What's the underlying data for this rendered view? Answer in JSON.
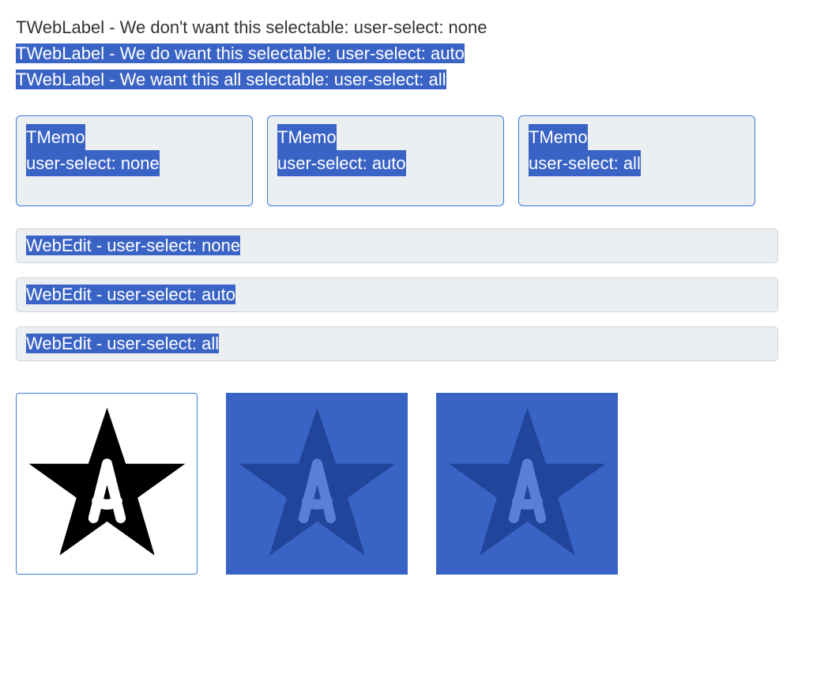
{
  "labels": {
    "none": "TWebLabel - We don't want this selectable: user-select: none",
    "auto": "TWebLabel - We do want this selectable: user-select: auto",
    "all": "TWebLabel - We want this all selectable: user-select: all"
  },
  "memos": {
    "none": {
      "line1": "TMemo",
      "line2": "user-select: none"
    },
    "auto": {
      "line1": "TMemo",
      "line2": "user-select: auto"
    },
    "all": {
      "line1": "TMemo",
      "line2": "user-select: all"
    }
  },
  "edits": {
    "none": "WebEdit - user-select: none",
    "auto": "WebEdit - user-select: auto",
    "all": "WebEdit - user-select: all"
  },
  "images": {
    "icon_name": "star-letter-a-icon"
  }
}
